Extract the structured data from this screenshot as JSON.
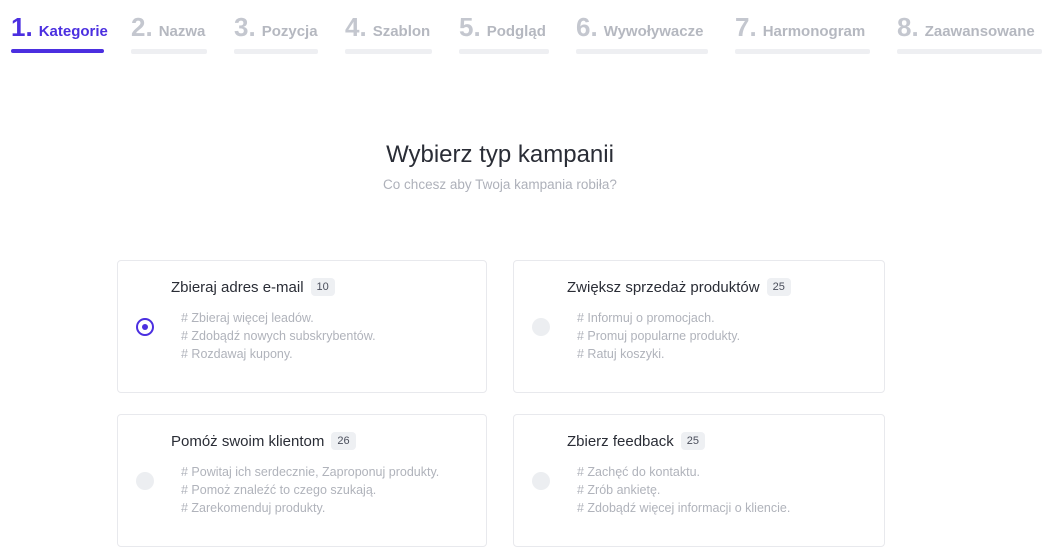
{
  "steps": [
    {
      "num": "1.",
      "label": "Kategorie",
      "active": true
    },
    {
      "num": "2.",
      "label": "Nazwa",
      "active": false
    },
    {
      "num": "3.",
      "label": "Pozycja",
      "active": false
    },
    {
      "num": "4.",
      "label": "Szablon",
      "active": false
    },
    {
      "num": "5.",
      "label": "Podgląd",
      "active": false
    },
    {
      "num": "6.",
      "label": "Wywoływacze",
      "active": false
    },
    {
      "num": "7.",
      "label": "Harmonogram",
      "active": false
    },
    {
      "num": "8.",
      "label": "Zaawansowane",
      "active": false
    }
  ],
  "page": {
    "title": "Wybierz typ kampanii",
    "subtitle": "Co chcesz aby Twoja kampania robiła?"
  },
  "campaign_types": [
    {
      "title": "Zbieraj adres e-mail",
      "count": "10",
      "selected": true,
      "tags": [
        "# Zbieraj więcej leadów.",
        "# Zdobądź nowych subskrybentów.",
        "# Rozdawaj kupony."
      ]
    },
    {
      "title": "Zwiększ sprzedaż produktów",
      "count": "25",
      "selected": false,
      "tags": [
        "# Informuj o promocjach.",
        "# Promuj popularne produkty.",
        "# Ratuj koszyki."
      ]
    },
    {
      "title": "Pomóż swoim klientom",
      "count": "26",
      "selected": false,
      "tags": [
        "# Powitaj ich serdecznie, Zaproponuj produkty.",
        "# Pomoż znaleźć to czego szukają.",
        "# Zarekomenduj produkty."
      ]
    },
    {
      "title": "Zbierz feedback",
      "count": "25",
      "selected": false,
      "tags": [
        "# Zachęć do kontaktu.",
        "# Zrób ankietę.",
        "# Zdobądź więcej informacji o kliencie."
      ]
    }
  ],
  "colors": {
    "accent": "#4b2fe0",
    "inactive": "#c4c7cf"
  }
}
